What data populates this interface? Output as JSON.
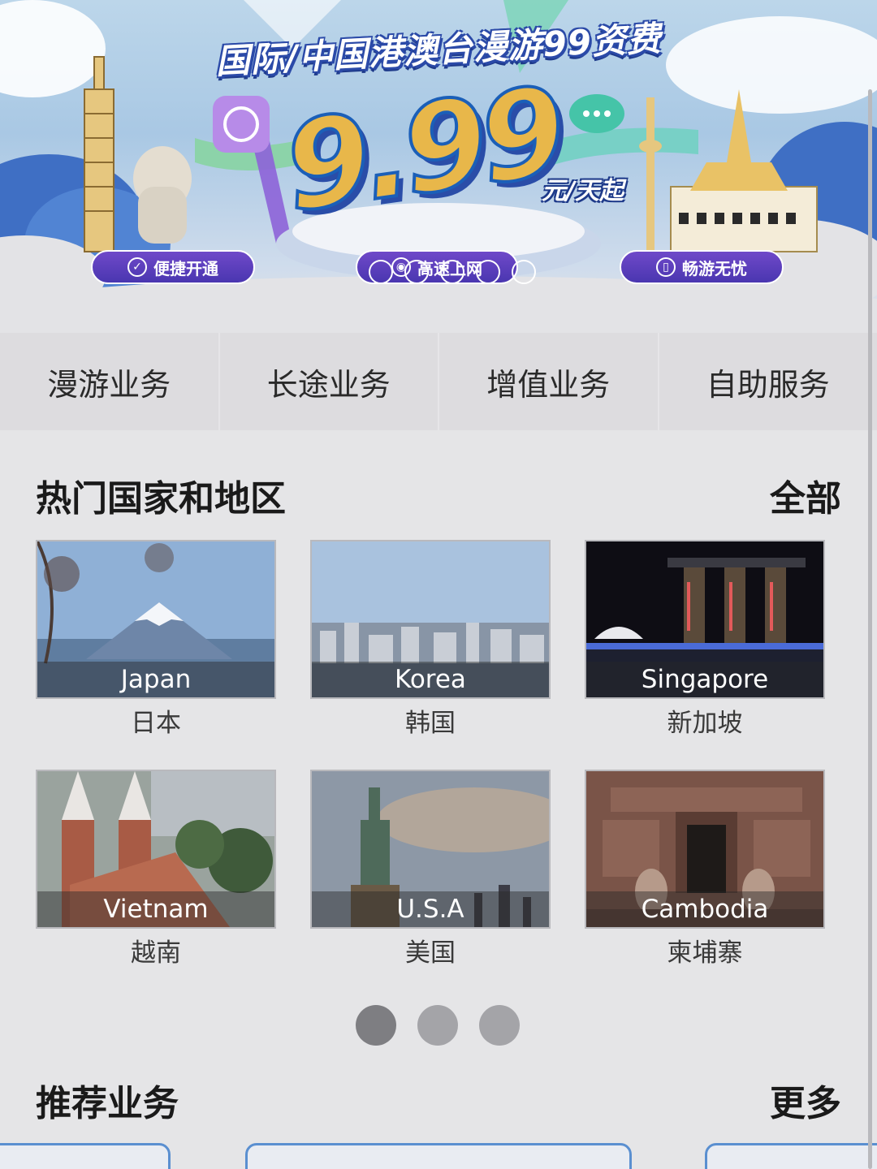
{
  "banner": {
    "title": "国际/中国港澳台漫游99资费",
    "price": "9.99",
    "price_unit": "元/天起",
    "features": [
      {
        "label": "便捷开通",
        "icon": "check-circle-icon"
      },
      {
        "label": "高速上网",
        "icon": "wifi-icon"
      },
      {
        "label": "畅游无忧",
        "icon": "phone-icon"
      }
    ],
    "carousel_slides": 5
  },
  "tabs": [
    {
      "label": "漫游业务"
    },
    {
      "label": "长途业务"
    },
    {
      "label": "增值业务"
    },
    {
      "label": "自助服务"
    }
  ],
  "hot_section": {
    "title": "热门国家和地区",
    "link": "全部",
    "destinations": [
      {
        "en": "Japan",
        "zh": "日本"
      },
      {
        "en": "Korea",
        "zh": "韩国"
      },
      {
        "en": "Singapore",
        "zh": "新加坡"
      },
      {
        "en": "Vietnam",
        "zh": "越南"
      },
      {
        "en": "U.S.A",
        "zh": "美国"
      },
      {
        "en": "Cambodia",
        "zh": "柬埔寨"
      }
    ],
    "pages": 3,
    "current_page": 1
  },
  "recommended_section": {
    "title": "推荐业务",
    "link": "更多"
  },
  "colors": {
    "pill": "#5a3fbf",
    "tab_bg": "#dddcdf",
    "page_bg": "#e5e5e7",
    "price_fill": "#e8b74a",
    "price_stroke": "#1b5fb8"
  }
}
